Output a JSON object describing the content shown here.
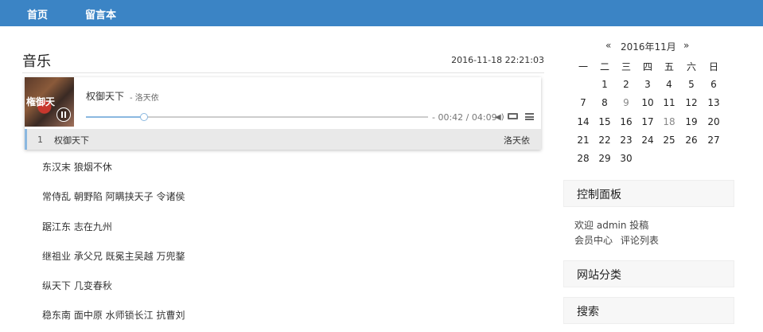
{
  "nav": {
    "home": "首页",
    "guestbook": "留言本"
  },
  "post": {
    "title": "音乐",
    "date": "2016-11-18 22:21:03"
  },
  "player": {
    "cover_text": "権御天",
    "song_name": "权御天下",
    "song_artist": "- 洛天依",
    "progress": 0.17,
    "time": "- 00:42 / 04:09",
    "icons": {
      "volume": "volume-icon",
      "loop": "loop-icon",
      "menu": "menu-icon",
      "pause": "pause-icon"
    },
    "playlist": [
      {
        "num": "1",
        "name": "权御天下",
        "artist": "洛天依"
      }
    ]
  },
  "lyrics": [
    "东汉末 狼烟不休",
    "常侍乱 朝野陷 阿瞒挟天子 令诸侯",
    "踞江东 志在九州",
    "继祖业 承父兄 既冕主吴越 万兜鍪",
    "纵天下 几变春秋",
    "稳东南 面中原 水师锁长江 抗曹刘"
  ],
  "calendar": {
    "prev": "«",
    "month": "2016年11月",
    "next": "»",
    "weekdays": [
      "一",
      "二",
      "三",
      "四",
      "五",
      "六",
      "日"
    ],
    "rows": [
      [
        "",
        "1",
        "2",
        "3",
        "4",
        "5",
        "6"
      ],
      [
        "7",
        "8",
        "9",
        "10",
        "11",
        "12",
        "13"
      ],
      [
        "14",
        "15",
        "16",
        "17",
        "18",
        "19",
        "20"
      ],
      [
        "21",
        "22",
        "23",
        "24",
        "25",
        "26",
        "27"
      ],
      [
        "28",
        "29",
        "30",
        "",
        "",
        "",
        ""
      ]
    ]
  },
  "widgets": {
    "control_panel": "控制面板",
    "welcome": "欢迎",
    "user": "admin",
    "post_link": "投稿",
    "member_center": "会员中心",
    "comment_list": "评论列表",
    "categories": "网站分类",
    "search": "搜索"
  },
  "colors": {
    "topbar": "#3b84c5",
    "accent": "#8bb8e0"
  }
}
